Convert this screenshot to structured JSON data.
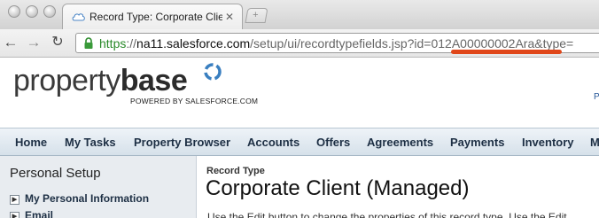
{
  "browser": {
    "tab_title": "Record Type: Corporate Clie",
    "tab_close": "✕",
    "new_tab": "+",
    "url_scheme": "https",
    "url_sep": "://",
    "url_host": "na11.salesforce.com",
    "url_path": "/setup/ui/recordtypefields.jsp?id=012A00000002Ara&type=",
    "highlight_color": "#e0471a"
  },
  "header": {
    "logo_regular": "property",
    "logo_bold": "base",
    "powered_by": "POWERED BY SALESFORCE.COM",
    "corner_text": "P",
    "logo_mark_color": "#3a7fc0"
  },
  "nav": {
    "items": [
      "Home",
      "My Tasks",
      "Property Browser",
      "Accounts",
      "Offers",
      "Agreements",
      "Payments",
      "Inventory",
      "M"
    ]
  },
  "sidebar": {
    "title": "Personal Setup",
    "links": [
      "My Personal Information",
      "Email"
    ]
  },
  "main": {
    "breadcrumb": "Record Type",
    "title": "Corporate Client (Managed)",
    "description": "Use the Edit button to change the properties of this record type. Use the Edit"
  }
}
